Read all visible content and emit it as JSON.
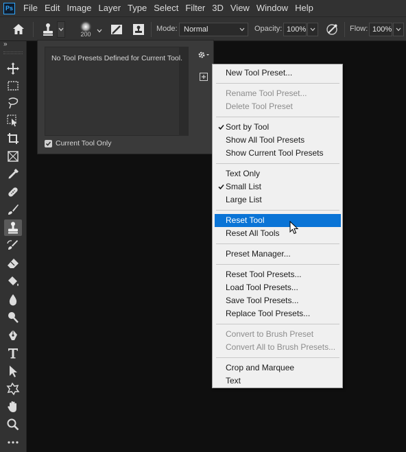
{
  "menubar": {
    "logo": "Ps",
    "items": [
      "File",
      "Edit",
      "Image",
      "Layer",
      "Type",
      "Select",
      "Filter",
      "3D",
      "View",
      "Window",
      "Help"
    ]
  },
  "options_bar": {
    "home_icon": "home-icon",
    "brush_size": "200",
    "mode_label": "Mode:",
    "mode_value": "Normal",
    "opacity_label": "Opacity:",
    "opacity_value": "100%",
    "flow_label": "Flow:",
    "flow_value": "100%"
  },
  "toolbar": {
    "collapse": "»",
    "tools": [
      {
        "name": "move-tool-icon"
      },
      {
        "name": "marquee-tool-icon"
      },
      {
        "name": "lasso-tool-icon"
      },
      {
        "name": "object-selection-tool-icon"
      },
      {
        "name": "crop-tool-icon"
      },
      {
        "name": "frame-tool-icon"
      },
      {
        "name": "eyedropper-tool-icon"
      },
      {
        "name": "healing-brush-tool-icon"
      },
      {
        "name": "brush-tool-icon"
      },
      {
        "name": "clone-stamp-tool-icon",
        "active": true
      },
      {
        "name": "history-brush-tool-icon"
      },
      {
        "name": "eraser-tool-icon"
      },
      {
        "name": "paint-bucket-tool-icon"
      },
      {
        "name": "blur-tool-icon"
      },
      {
        "name": "dodge-tool-icon"
      },
      {
        "name": "pen-tool-icon"
      },
      {
        "name": "type-tool-icon"
      },
      {
        "name": "path-selection-tool-icon"
      },
      {
        "name": "custom-shape-tool-icon"
      },
      {
        "name": "hand-tool-icon"
      },
      {
        "name": "zoom-tool-icon"
      },
      {
        "name": "more-tools-icon"
      }
    ]
  },
  "presets_panel": {
    "empty_message": "No Tool Presets Defined for Current Tool.",
    "current_only_label": "Current Tool Only",
    "current_only_checked": true
  },
  "context_menu": {
    "groups": [
      [
        {
          "label": "New Tool Preset..."
        }
      ],
      [
        {
          "label": "Rename Tool Preset...",
          "disabled": true
        },
        {
          "label": "Delete Tool Preset",
          "disabled": true
        }
      ],
      [
        {
          "label": "Sort by Tool",
          "checked": true
        },
        {
          "label": "Show All Tool Presets"
        },
        {
          "label": "Show Current Tool Presets"
        }
      ],
      [
        {
          "label": "Text Only"
        },
        {
          "label": "Small List",
          "checked": true
        },
        {
          "label": "Large List"
        }
      ],
      [
        {
          "label": "Reset Tool",
          "highlighted": true
        },
        {
          "label": "Reset All Tools"
        }
      ],
      [
        {
          "label": "Preset Manager..."
        }
      ],
      [
        {
          "label": "Reset Tool Presets..."
        },
        {
          "label": "Load Tool Presets..."
        },
        {
          "label": "Save Tool Presets..."
        },
        {
          "label": "Replace Tool Presets..."
        }
      ],
      [
        {
          "label": "Convert to Brush Preset",
          "disabled": true
        },
        {
          "label": "Convert All to Brush Presets...",
          "disabled": true
        }
      ],
      [
        {
          "label": "Crop and Marquee"
        },
        {
          "label": "Text"
        }
      ]
    ]
  },
  "colors": {
    "highlight": "#0a74d6",
    "ps_blue": "#31a8ff"
  }
}
